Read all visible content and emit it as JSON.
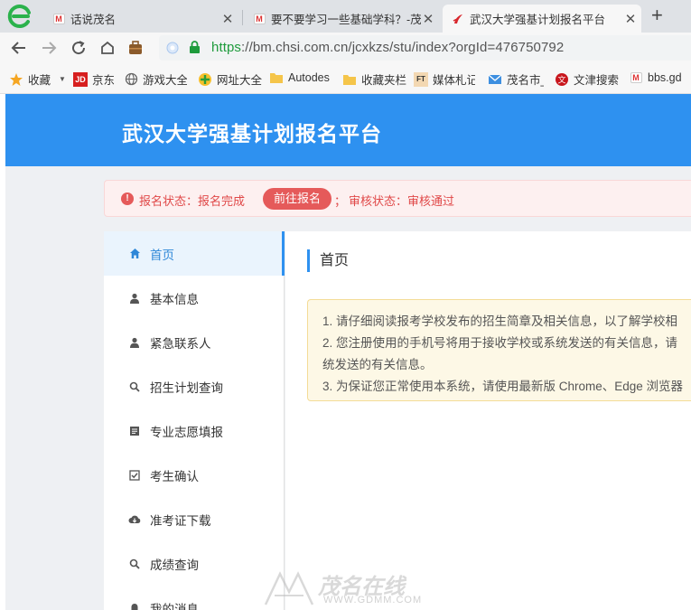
{
  "browser": {
    "tabs": [
      {
        "title": "话说茂名"
      },
      {
        "title": "要不要学习一些基础学科？-茂名"
      },
      {
        "title": "武汉大学强基计划报名平台"
      }
    ],
    "new_tab_label": "+",
    "close_label": "✕",
    "url": {
      "scheme": "https",
      "rest": "://bm.chsi.com.cn/jcxkzs/stu/index?orgId=476750792"
    },
    "bookmarks": [
      {
        "label": "收藏",
        "icon": "star-icon"
      },
      {
        "label": "京东",
        "icon": "jd-icon"
      },
      {
        "label": "游戏大全",
        "icon": "globe-icon"
      },
      {
        "label": "网址大全",
        "icon": "sites-icon"
      },
      {
        "label": "Autodes",
        "icon": "folder-icon"
      },
      {
        "label": "收藏夹栏",
        "icon": "folder-icon"
      },
      {
        "label": "媒体札记",
        "icon": "ft-icon"
      },
      {
        "label": "茂名市_",
        "icon": "mail-icon"
      },
      {
        "label": "文津搜索",
        "icon": "wenjin-icon"
      },
      {
        "label": "bbs.gd",
        "icon": "m-icon"
      }
    ]
  },
  "site": {
    "title": "武汉大学强基计划报名平台"
  },
  "status": {
    "icon": "!",
    "reg_status": "报名状态：报名完成",
    "button": "前往报名",
    "separator": "；",
    "review_status": "审核状态：审核通过"
  },
  "menu": [
    {
      "label": "首页",
      "icon": "home-icon",
      "active": true
    },
    {
      "label": "基本信息",
      "icon": "user-icon"
    },
    {
      "label": "紧急联系人",
      "icon": "user-icon"
    },
    {
      "label": "招生计划查询",
      "icon": "search-icon"
    },
    {
      "label": "专业志愿填报",
      "icon": "form-icon"
    },
    {
      "label": "考生确认",
      "icon": "check-square-icon"
    },
    {
      "label": "准考证下载",
      "icon": "cloud-download-icon"
    },
    {
      "label": "成绩查询",
      "icon": "search-icon"
    },
    {
      "label": "我的消息",
      "icon": "bell-icon"
    }
  ],
  "main": {
    "heading": "首页",
    "notices": [
      "1. 请仔细阅读报考学校发布的招生简章及相关信息，以了解学校相",
      "2. 您注册使用的手机号将用于接收学校或系统发送的有关信息，请",
      "统发送的有关信息。",
      "3. 为保证您正常使用本系统，请使用最新版 Chrome、Edge 浏览器"
    ]
  },
  "watermark": {
    "text": "茂名在线",
    "url": "WWW.GDMM.COM"
  },
  "colors": {
    "primary": "#2e91f0",
    "status_red": "#e55a5a",
    "notice_bg": "#fdf8e6"
  }
}
